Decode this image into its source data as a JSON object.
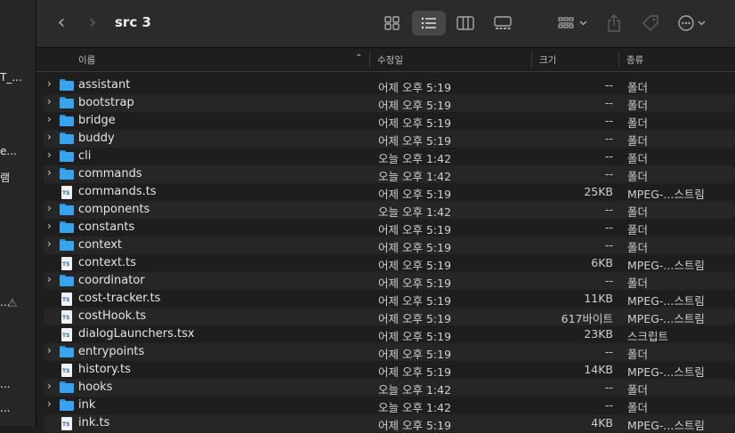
{
  "sidebar": {
    "fragments": [
      "T_...",
      "e...",
      "램",
      "...",
      "...",
      "..."
    ]
  },
  "toolbar": {
    "back": "‹",
    "forward": "›",
    "title": "src 3"
  },
  "columns": {
    "name": "이름",
    "date": "수정일",
    "size": "크기",
    "kind": "종류"
  },
  "rows": [
    {
      "type": "folder",
      "name": "assistant",
      "date": "어제 오후 5:19",
      "size": "--",
      "kind": "폴더"
    },
    {
      "type": "folder",
      "name": "bootstrap",
      "date": "어제 오후 5:19",
      "size": "--",
      "kind": "폴더"
    },
    {
      "type": "folder",
      "name": "bridge",
      "date": "어제 오후 5:19",
      "size": "--",
      "kind": "폴더"
    },
    {
      "type": "folder",
      "name": "buddy",
      "date": "어제 오후 5:19",
      "size": "--",
      "kind": "폴더"
    },
    {
      "type": "folder",
      "name": "cli",
      "date": "오늘 오후 1:42",
      "size": "--",
      "kind": "폴더"
    },
    {
      "type": "folder",
      "name": "commands",
      "date": "오늘 오후 1:42",
      "size": "--",
      "kind": "폴더"
    },
    {
      "type": "file",
      "name": "commands.ts",
      "date": "어제 오후 5:19",
      "size": "25KB",
      "kind": "MPEG-...스트림"
    },
    {
      "type": "folder",
      "name": "components",
      "date": "오늘 오후 1:42",
      "size": "--",
      "kind": "폴더"
    },
    {
      "type": "folder",
      "name": "constants",
      "date": "어제 오후 5:19",
      "size": "--",
      "kind": "폴더"
    },
    {
      "type": "folder",
      "name": "context",
      "date": "어제 오후 5:19",
      "size": "--",
      "kind": "폴더"
    },
    {
      "type": "file",
      "name": "context.ts",
      "date": "어제 오후 5:19",
      "size": "6KB",
      "kind": "MPEG-...스트림"
    },
    {
      "type": "folder",
      "name": "coordinator",
      "date": "어제 오후 5:19",
      "size": "--",
      "kind": "폴더"
    },
    {
      "type": "file",
      "name": "cost-tracker.ts",
      "date": "어제 오후 5:19",
      "size": "11KB",
      "kind": "MPEG-...스트림"
    },
    {
      "type": "file",
      "name": "costHook.ts",
      "date": "어제 오후 5:19",
      "size": "617바이트",
      "kind": "MPEG-...스트림"
    },
    {
      "type": "file",
      "name": "dialogLaunchers.tsx",
      "date": "어제 오후 5:19",
      "size": "23KB",
      "kind": "스크립트"
    },
    {
      "type": "folder",
      "name": "entrypoints",
      "date": "어제 오후 5:19",
      "size": "--",
      "kind": "폴더"
    },
    {
      "type": "file",
      "name": "history.ts",
      "date": "어제 오후 5:19",
      "size": "14KB",
      "kind": "MPEG-...스트림"
    },
    {
      "type": "folder",
      "name": "hooks",
      "date": "오늘 오후 1:42",
      "size": "--",
      "kind": "폴더"
    },
    {
      "type": "folder",
      "name": "ink",
      "date": "오늘 오후 1:42",
      "size": "--",
      "kind": "폴더"
    },
    {
      "type": "file",
      "name": "ink.ts",
      "date": "어제 오후 5:19",
      "size": "4KB",
      "kind": "MPEG-...스트림"
    }
  ]
}
